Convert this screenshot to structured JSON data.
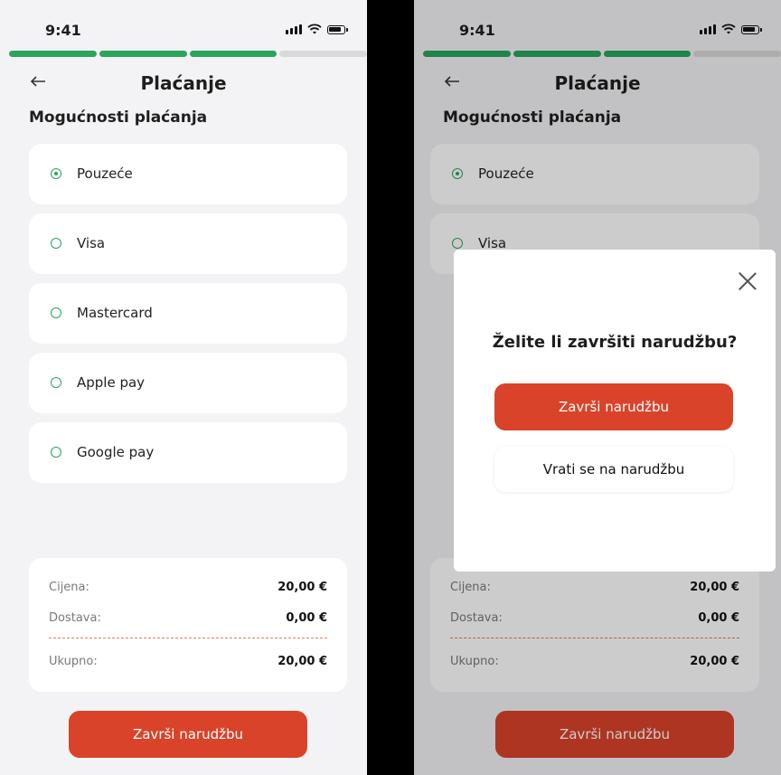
{
  "status": {
    "time": "9:41"
  },
  "progress": {
    "steps": 4,
    "completed": 3
  },
  "header": {
    "title": "Plaćanje"
  },
  "section_title": "Mogućnosti plaćanja",
  "payment_options": [
    {
      "label": "Pouzeće",
      "selected": true
    },
    {
      "label": "Visa",
      "selected": false
    },
    {
      "label": "Mastercard",
      "selected": false
    },
    {
      "label": "Apple pay",
      "selected": false
    },
    {
      "label": "Google pay",
      "selected": false
    }
  ],
  "summary": {
    "price_label": "Cijena:",
    "price_value": "20,00 €",
    "delivery_label": "Dostava:",
    "delivery_value": "0,00 €",
    "total_label": "Ukupno:",
    "total_value": "20,00 €"
  },
  "cta_label": "Završi narudžbu",
  "modal": {
    "question": "Želite li završiti narudžbu?",
    "primary_label": "Završi narudžbu",
    "secondary_label": "Vrati se na narudžbu"
  },
  "colors": {
    "accent": "#d9432a",
    "success": "#2aa55a",
    "background": "#f3f3f5"
  },
  "icons": [
    "back-arrow-icon",
    "signal-icon",
    "wifi-icon",
    "battery-icon",
    "radio-icon",
    "close-icon"
  ]
}
